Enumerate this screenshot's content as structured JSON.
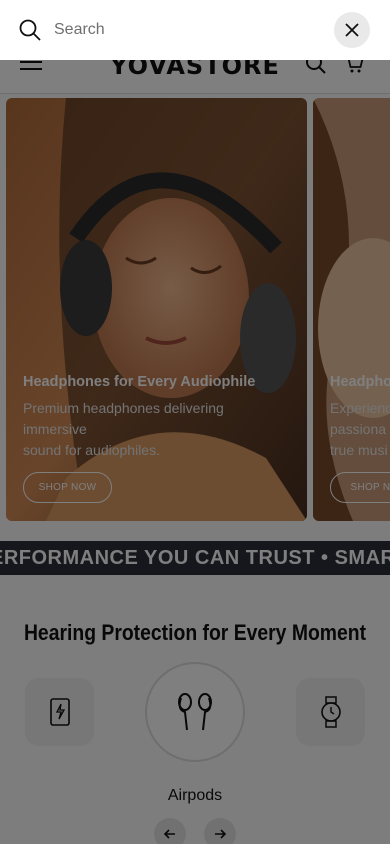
{
  "search": {
    "placeholder": "Search"
  },
  "header": {
    "logo": "YOVASTORE"
  },
  "slides": [
    {
      "title": "Headphones for Every Audiophile",
      "description_lines": [
        "Premium headphones delivering",
        "immersive",
        "sound for audiophiles."
      ],
      "button": "SHOP NOW"
    },
    {
      "title": "Headpho",
      "description_lines": [
        "Experienc",
        "passiona",
        "true musi"
      ],
      "button": "SHOP NO"
    }
  ],
  "marquee": {
    "text": "ERFORMANCE YOU CAN TRUST  •  SMART"
  },
  "category_section": {
    "title": "Hearing Protection for Every Moment",
    "categories": [
      {
        "icon": "power-bank-icon"
      },
      {
        "icon": "earbuds-icon",
        "label": "Airpods"
      },
      {
        "icon": "smartwatch-icon"
      }
    ]
  },
  "colors": {
    "marquee_bg": "#2c2c3a",
    "overlay": "#000000"
  }
}
